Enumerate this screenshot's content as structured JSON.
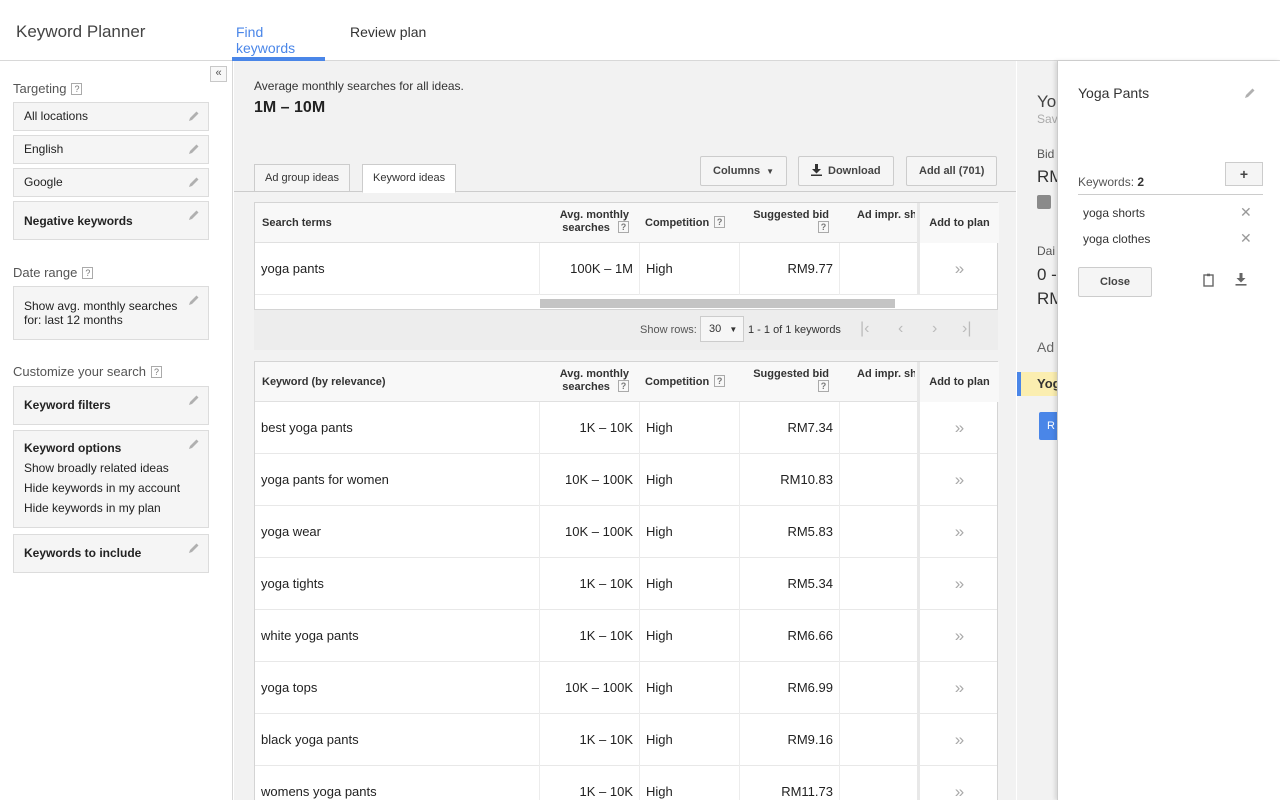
{
  "header": {
    "app_title": "Keyword Planner",
    "tabs": [
      {
        "label": "Find keywords",
        "active": true
      },
      {
        "label": "Review plan",
        "active": false
      }
    ]
  },
  "sidebar": {
    "collapse_icon": "«",
    "targeting_label": "Targeting",
    "help_glyph": "?",
    "targeting": [
      "All locations",
      "English",
      "Google",
      "Negative keywords"
    ],
    "date_range_label": "Date range",
    "date_range_text": "Show avg. monthly searches for: last 12 months",
    "customize_label": "Customize your search",
    "keyword_filters": "Keyword filters",
    "keyword_options": {
      "title": "Keyword options",
      "items": [
        "Show broadly related ideas",
        "Hide keywords in my account",
        "Hide keywords in my plan"
      ]
    },
    "keywords_to_include": "Keywords to include"
  },
  "main": {
    "avg_label": "Average monthly searches for all ideas.",
    "avg_value": "1M – 10M",
    "idea_tabs": [
      "Ad group ideas",
      "Keyword ideas"
    ],
    "buttons": {
      "columns": "Columns",
      "download": "Download",
      "add_all": "Add all (701)"
    },
    "search_table": {
      "headers": {
        "term": "Search terms",
        "avg": "Avg. monthly searches",
        "competition": "Competition",
        "bid": "Suggested bid",
        "impr": "Ad impr. sh",
        "add": "Add to plan"
      },
      "rows": [
        {
          "term": "yoga pants",
          "avg": "100K – 1M",
          "competition": "High",
          "bid": "RM9.77"
        }
      ]
    },
    "pager": {
      "show_rows_label": "Show rows:",
      "rows_value": "30",
      "count_text": "1 - 1 of 1 keywords"
    },
    "keyword_table": {
      "headers": {
        "term": "Keyword (by relevance)",
        "avg": "Avg. monthly searches",
        "competition": "Competition",
        "bid": "Suggested bid",
        "impr": "Ad impr. sh",
        "add": "Add to plan"
      },
      "rows": [
        {
          "term": "best yoga pants",
          "avg": "1K – 10K",
          "competition": "High",
          "bid": "RM7.34"
        },
        {
          "term": "yoga pants for women",
          "avg": "10K – 100K",
          "competition": "High",
          "bid": "RM10.83"
        },
        {
          "term": "yoga wear",
          "avg": "10K – 100K",
          "competition": "High",
          "bid": "RM5.83"
        },
        {
          "term": "yoga tights",
          "avg": "1K – 10K",
          "competition": "High",
          "bid": "RM5.34"
        },
        {
          "term": "white yoga pants",
          "avg": "1K – 10K",
          "competition": "High",
          "bid": "RM6.66"
        },
        {
          "term": "yoga tops",
          "avg": "10K – 100K",
          "competition": "High",
          "bid": "RM6.99"
        },
        {
          "term": "black yoga pants",
          "avg": "1K – 10K",
          "competition": "High",
          "bid": "RM9.16"
        },
        {
          "term": "womens yoga pants",
          "avg": "1K – 10K",
          "competition": "High",
          "bid": "RM11.73"
        }
      ]
    },
    "add_glyph": "»"
  },
  "background_panel": {
    "title_partial": "Yo",
    "sub_partial": "Sav",
    "bid_partial": "Bid",
    "bid_val_partial": "RM",
    "daily_partial": "Dai",
    "daily_val_partial": "0 -",
    "daily_val2_partial": "RM",
    "ad_partial": "Ad",
    "yog_partial": "Yog",
    "btn_partial": "R"
  },
  "plan_panel": {
    "title": "Yoga Pants",
    "keywords_label": "Keywords:",
    "keywords_count": "2",
    "add_glyph": "+",
    "keywords": [
      "yoga shorts",
      "yoga clothes"
    ],
    "remove_glyph": "✕",
    "close_label": "Close"
  },
  "colors": {
    "accent": "#4a86e8",
    "highlight": "#fbeeb0"
  }
}
